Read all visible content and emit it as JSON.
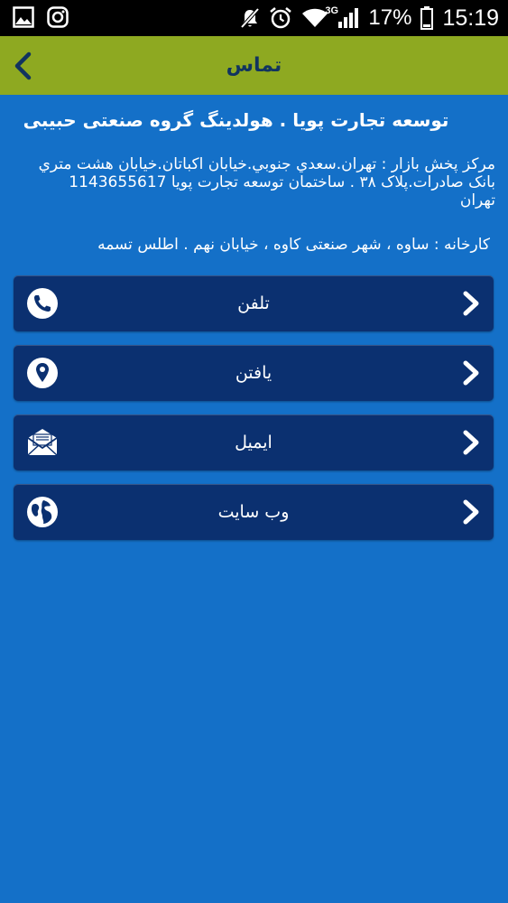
{
  "status_bar": {
    "network": "3G",
    "battery_percent": "17%",
    "time": "15:19"
  },
  "app_bar": {
    "title": "تماس"
  },
  "company": {
    "title": "توسعه تجارت پویا . هولدینگ گروه صنعتی حبیبی",
    "address": "مرکز پخش بازار : تهران.سعدي جنوبي.خيابان اکباتان.خيابان هشت متري بانک صادرات.پلاک ۳۸ . ساختمان توسعه تجارت پويا 1143655617 تهران",
    "factory": "کارخانه : ساوه ، شهر صنعتی کاوه ، خیابان نهم . اطلس تسمه"
  },
  "buttons": [
    {
      "label": "تلفن",
      "icon": "phone-icon"
    },
    {
      "label": "یافتن",
      "icon": "location-pin-icon"
    },
    {
      "label": "ایمیل",
      "icon": "envelope-icon"
    },
    {
      "label": "وب سایت",
      "icon": "globe-icon"
    }
  ],
  "colors": {
    "background": "#1470c8",
    "app_bar": "#8ea921",
    "button": "#0b3070",
    "title_text": "#11345f"
  }
}
